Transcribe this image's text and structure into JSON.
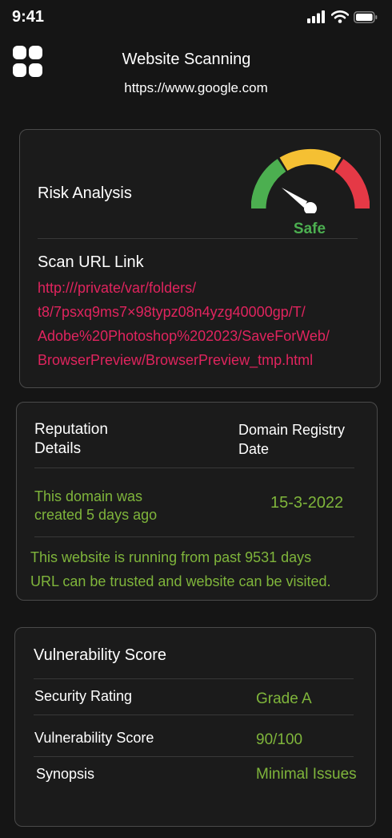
{
  "status_bar": {
    "time": "9:41"
  },
  "header": {
    "title": "Website Scanning",
    "url": "https://www.google.com"
  },
  "risk_card": {
    "title": "Risk Analysis",
    "gauge_label": "Safe",
    "gauge_colors": {
      "low": "#4caf50",
      "mid": "#f5c033",
      "high": "#e53946"
    },
    "scan_title": "Scan URL Link",
    "scan_url_lines": [
      "http:///private/var/folders/",
      "t8/7psxq9ms7×98typz08n4yzg40000gp/T/",
      "Adobe%20Photoshop%202023/SaveForWeb/",
      "BrowserPreview/BrowserPreview_tmp.html"
    ]
  },
  "reputation_card": {
    "left_heading": [
      "Reputation",
      "Details"
    ],
    "right_heading": [
      "Domain Registry",
      "Date"
    ],
    "created_text": [
      "This domain was",
      "created 5 days ago"
    ],
    "registry_date": "15-3-2022",
    "running_text": "This website is running from past 9531 days",
    "trust_text": "URL can be trusted and website can be visited."
  },
  "vulnerability_card": {
    "title": "Vulnerability Score",
    "rows": [
      {
        "label": "Security Rating",
        "value": "Grade A"
      },
      {
        "label": "Vulnerability Score",
        "value": "90/100"
      },
      {
        "label": "Synopsis",
        "value": "Minimal Issues"
      }
    ]
  }
}
